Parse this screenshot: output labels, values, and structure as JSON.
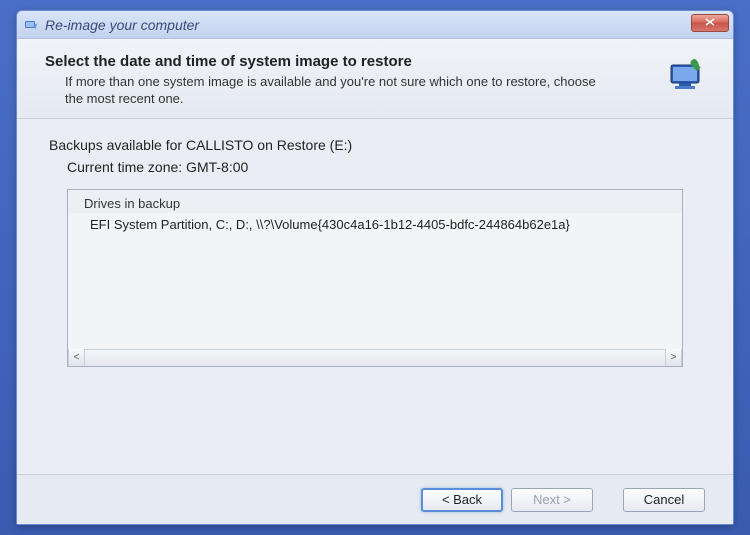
{
  "window": {
    "title": "Re-image your computer"
  },
  "header": {
    "heading": "Select the date and time of system image to restore",
    "subheading": "If more than one system image is available and you're not sure which one to restore, choose the most recent one."
  },
  "body": {
    "backups_label": "Backups available for CALLISTO on Restore (E:)",
    "timezone_label": "Current time zone: GMT-8:00",
    "list": {
      "column_header": "Drives in backup",
      "rows": [
        "EFI System Partition, C:, D:, \\\\?\\Volume{430c4a16-1b12-4405-bdfc-244864b62e1a}"
      ]
    }
  },
  "footer": {
    "back": "< Back",
    "next": "Next >",
    "cancel": "Cancel"
  }
}
